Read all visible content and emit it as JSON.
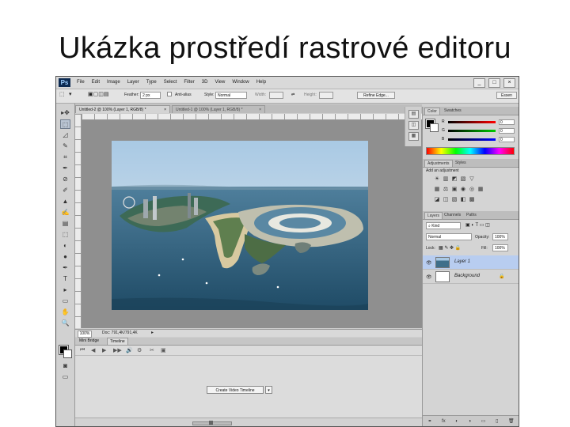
{
  "slide_title": "Ukázka prostředí rastrové editoru",
  "app": {
    "logo": "Ps",
    "menu": [
      "File",
      "Edit",
      "Image",
      "Layer",
      "Type",
      "Select",
      "Filter",
      "3D",
      "View",
      "Window",
      "Help"
    ],
    "window_controls": [
      "_",
      "□",
      "×"
    ]
  },
  "options_bar": {
    "feather_label": "Feather:",
    "feather_value": "2 px",
    "antialias_label": "Anti-alias",
    "style_label": "Style:",
    "style_value": "Normal",
    "width_label": "Width:",
    "height_label": "Height:",
    "refine_edge": "Refine Edge...",
    "workspace": "Essen"
  },
  "document_tabs": [
    {
      "label": "Untitled-2 @ 100% (Layer 1, RGB/8) *",
      "close": "×",
      "active": true
    },
    {
      "label": "Untitled-1 @ 100% (Layer 1, RGB/8) *",
      "close": "×",
      "active": false
    }
  ],
  "status_bar": {
    "zoom": "100%",
    "doc_info": "Doc: 791,4K/791,4K",
    "arrow": "▸"
  },
  "timeline": {
    "tabs": [
      "Mini Bridge",
      "Timeline"
    ],
    "create_button": "Create Video Timeline",
    "dropdown": "▾",
    "controls": [
      "⏮",
      "◀",
      "▶",
      "▶▶",
      "🔊",
      "⚙",
      "✂",
      "▣"
    ]
  },
  "tools": [
    "▸✥",
    "⬚",
    "◿",
    "✎",
    "⌗",
    "✒",
    "⊘",
    "✐",
    "▲",
    "✍",
    "▤",
    "⬚",
    "◐",
    "●",
    "✒",
    "T",
    "▸",
    "▭",
    "✋",
    "🔍"
  ],
  "color_panel": {
    "tabs": [
      "Color",
      "Swatches"
    ],
    "sliders": [
      {
        "letter": "R",
        "value": "0",
        "color": "#ff0000"
      },
      {
        "letter": "G",
        "value": "0",
        "color": "#00c000"
      },
      {
        "letter": "B",
        "value": "0",
        "color": "#0000ff"
      }
    ]
  },
  "adjustments_panel": {
    "tabs": [
      "Adjustments",
      "Styles"
    ],
    "label": "Add an adjustment",
    "row1": [
      "☀",
      "▥",
      "◩",
      "▧",
      "▽"
    ],
    "row2": [
      "▦",
      "⚖",
      "▣",
      "◉",
      "◎",
      "▦"
    ],
    "row3": [
      "◪",
      "◫",
      "▧",
      "◧",
      "▩"
    ]
  },
  "layers_panel": {
    "tabs": [
      "Layers",
      "Channels",
      "Paths"
    ],
    "kind": "Kind",
    "blend_mode": "Normal",
    "opacity_label": "Opacity:",
    "opacity_value": "100%",
    "lock_label": "Lock:",
    "fill_label": "Fill:",
    "fill_value": "100%",
    "layers": [
      {
        "name": "Layer 1",
        "selected": true
      },
      {
        "name": "Background",
        "selected": false,
        "lock": "🔒"
      }
    ],
    "footer": [
      "⚭",
      "fx",
      "◐",
      "◑",
      "▭",
      "▯",
      "🗑"
    ]
  },
  "colors": {
    "accent_selected_layer": "#b8cdf0",
    "window_bg": "#cfcfcf",
    "canvas_bg": "#8f8f8f"
  }
}
